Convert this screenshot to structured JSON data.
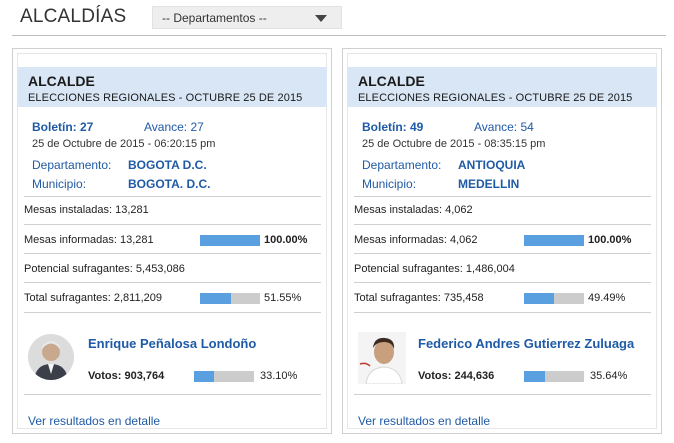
{
  "header": {
    "title": "ALCALDÍAS",
    "select_value": "-- Departamentos --"
  },
  "cards": [
    {
      "title": "ALCALDE",
      "subtitle": "ELECCIONES REGIONALES - OCTUBRE 25 DE 2015",
      "boletin_label": "Boletín: 27",
      "avance_label": "Avance: 27",
      "timestamp": "25 de Octubre de 2015 - 06:20:15 pm",
      "departamento_label": "Departamento:",
      "departamento_value": "BOGOTA D.C.",
      "municipio_label": "Municipio:",
      "municipio_value": "BOGOTA. D.C.",
      "mesas_instaladas": "Mesas instaladas: 13,281",
      "mesas_informadas": "Mesas informadas: 13,281",
      "mesas_informadas_pct_text": "100.00%",
      "mesas_informadas_pct": 100.0,
      "potencial": "Potencial sufragantes: 5,453,086",
      "total_sufragantes": "Total sufragantes: 2,811,209",
      "total_pct_text": "51.55%",
      "total_pct": 51.55,
      "candidate_name": "Enrique Peñalosa Londoño",
      "votos": "Votos: 903,764",
      "votos_pct_text": "33.10%",
      "votos_pct": 33.1,
      "link": "Ver resultados en detalle"
    },
    {
      "title": "ALCALDE",
      "subtitle": "ELECCIONES REGIONALES - OCTUBRE 25 DE 2015",
      "boletin_label": "Boletín: 49",
      "avance_label": "Avance: 54",
      "timestamp": "25 de Octubre de 2015 - 08:35:15 pm",
      "departamento_label": "Departamento:",
      "departamento_value": "ANTIOQUIA",
      "municipio_label": "Municipio:",
      "municipio_value": "MEDELLIN",
      "mesas_instaladas": "Mesas instaladas: 4,062",
      "mesas_informadas": "Mesas informadas: 4,062",
      "mesas_informadas_pct_text": "100.00%",
      "mesas_informadas_pct": 100.0,
      "potencial": "Potencial sufragantes: 1,486,004",
      "total_sufragantes": "Total sufragantes: 735,458",
      "total_pct_text": "49.49%",
      "total_pct": 49.49,
      "candidate_name": "Federico Andres Gutierrez Zuluaga",
      "votos": "Votos: 244,636",
      "votos_pct_text": "35.64%",
      "votos_pct": 35.64,
      "link": "Ver resultados en detalle"
    }
  ]
}
